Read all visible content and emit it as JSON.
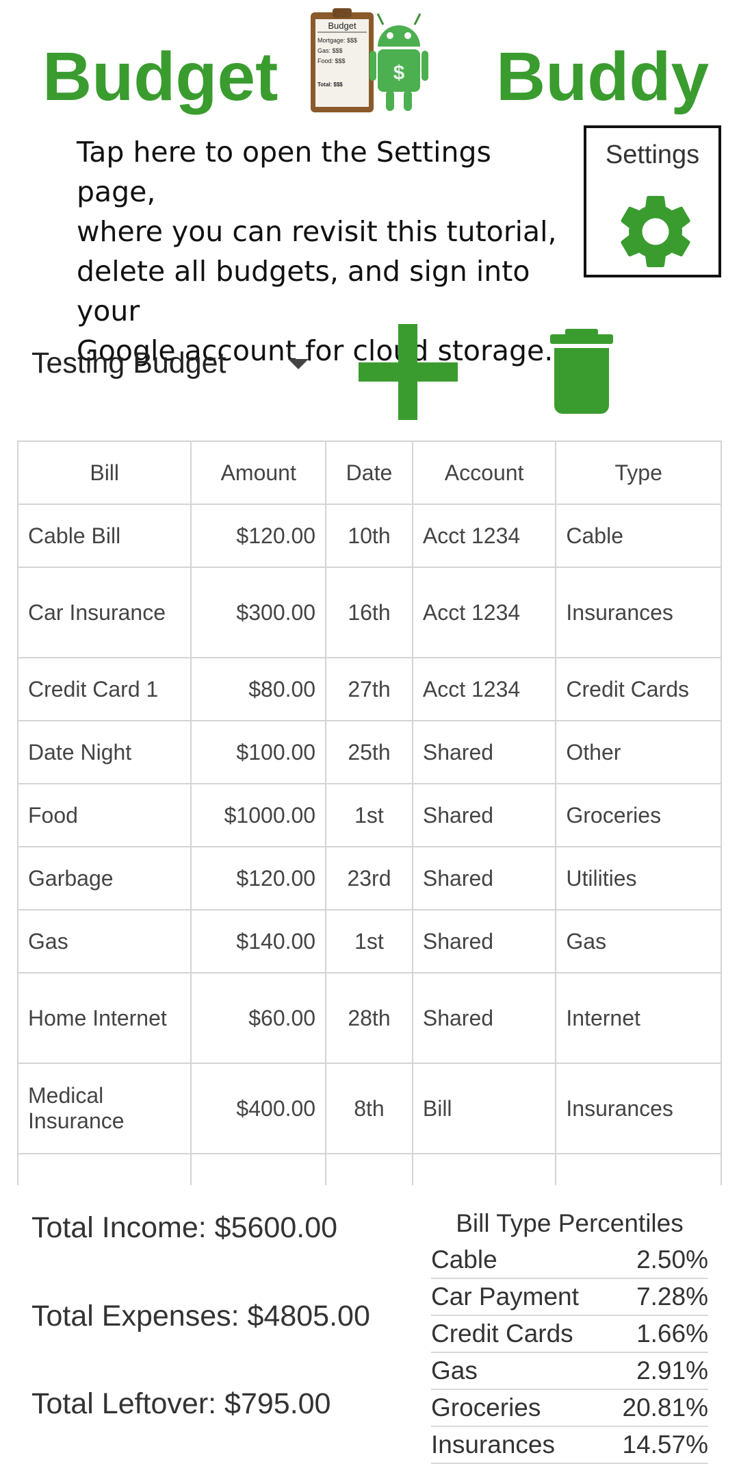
{
  "header": {
    "title_left": "Budget",
    "title_right": "Buddy",
    "logo": {
      "clipboard_title": "Budget",
      "clipboard_lines": [
        "Mortgage: $$$",
        "Gas: $$$",
        "Food: $$$"
      ],
      "clipboard_total": "Total: $$$",
      "robot_symbol": "$"
    }
  },
  "tutorial": {
    "text_lines": [
      "Tap here to open the Settings page,",
      "where you can revisit this tutorial,",
      "delete all budgets, and sign into your",
      "Google account for cloud storage."
    ]
  },
  "settings": {
    "label": "Settings",
    "icon": "gear-icon"
  },
  "budget": {
    "selected": "Testing Budget",
    "add_icon": "plus-icon",
    "delete_icon": "trash-icon"
  },
  "table": {
    "headers": [
      "Bill",
      "Amount",
      "Date",
      "Account",
      "Type"
    ],
    "rows": [
      {
        "bill": "Cable Bill",
        "amount": "$120.00",
        "date": "10th",
        "account": "Acct 1234",
        "type": "Cable"
      },
      {
        "bill": "Car Insurance",
        "amount": "$300.00",
        "date": "16th",
        "account": "Acct 1234",
        "type": "Insurances"
      },
      {
        "bill": "Credit Card 1",
        "amount": "$80.00",
        "date": "27th",
        "account": "Acct 1234",
        "type": "Credit Cards"
      },
      {
        "bill": "Date Night",
        "amount": "$100.00",
        "date": "25th",
        "account": "Shared",
        "type": "Other"
      },
      {
        "bill": "Food",
        "amount": "$1000.00",
        "date": "1st",
        "account": "Shared",
        "type": "Groceries"
      },
      {
        "bill": "Garbage",
        "amount": "$120.00",
        "date": "23rd",
        "account": "Shared",
        "type": "Utilities"
      },
      {
        "bill": "Gas",
        "amount": "$140.00",
        "date": "1st",
        "account": "Shared",
        "type": "Gas"
      },
      {
        "bill": "Home Internet",
        "amount": "$60.00",
        "date": "28th",
        "account": "Shared",
        "type": "Internet"
      },
      {
        "bill": "Medical Insurance",
        "amount": "$400.00",
        "date": "8th",
        "account": "Bill",
        "type": "Insurances"
      }
    ]
  },
  "totals": {
    "income": "Total Income: $5600.00",
    "expenses": "Total Expenses: $4805.00",
    "leftover": "Total Leftover: $795.00"
  },
  "percentiles": {
    "title": "Bill Type Percentiles",
    "rows": [
      {
        "type": "Cable",
        "pct": "2.50%"
      },
      {
        "type": "Car Payment",
        "pct": "7.28%"
      },
      {
        "type": "Credit Cards",
        "pct": "1.66%"
      },
      {
        "type": "Gas",
        "pct": "2.91%"
      },
      {
        "type": "Groceries",
        "pct": "20.81%"
      },
      {
        "type": "Insurances",
        "pct": "14.57%"
      }
    ]
  },
  "colors": {
    "accent": "#3a9c2f",
    "border": "#d4d4d4",
    "text": "#3a3a3a"
  }
}
